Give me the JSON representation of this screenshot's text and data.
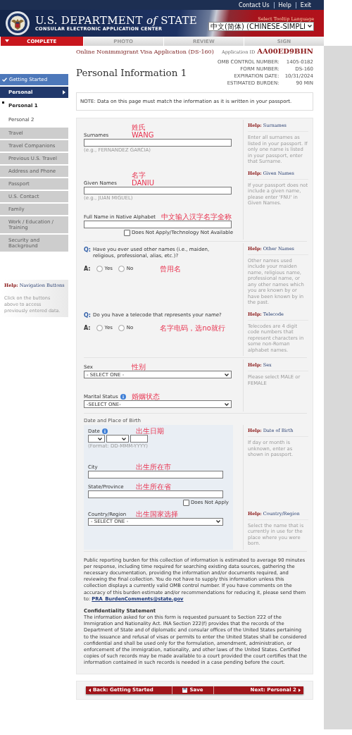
{
  "header": {
    "links": [
      "Contact Us",
      "Help",
      "Exit"
    ],
    "agency": "U.S. DEPARTMENT *of* STATE",
    "subtitle": "CONSULAR ELECTRONIC APPLICATION CENTER",
    "tooltip_label": "Select Tooltip Language",
    "language": "中文(简体) (CHINESE-SIMPLI"
  },
  "steps": [
    {
      "label": "COMPLETE",
      "selected": true
    },
    {
      "label": "PHOTO",
      "selected": false
    },
    {
      "label": "REVIEW",
      "selected": false
    },
    {
      "label": "SIGN",
      "selected": false
    }
  ],
  "sidebar": {
    "items": [
      {
        "kind": "done",
        "label": "Getting Started",
        "selected": false
      },
      {
        "kind": "section",
        "label": "Personal",
        "selected": false
      },
      {
        "kind": "sub",
        "label": "Personal 1",
        "selected": true
      },
      {
        "kind": "sub",
        "label": "Personal 2",
        "selected": false
      },
      {
        "kind": "pending",
        "label": "Travel",
        "selected": false
      },
      {
        "kind": "pending",
        "label": "Travel Companions",
        "selected": false
      },
      {
        "kind": "pending",
        "label": "Previous U.S. Travel",
        "selected": false
      },
      {
        "kind": "pending",
        "label": "Address and Phone",
        "selected": false
      },
      {
        "kind": "pending",
        "label": "Passport",
        "selected": false
      },
      {
        "kind": "pending",
        "label": "U.S. Contact",
        "selected": false
      },
      {
        "kind": "pending",
        "label": "Family",
        "selected": false
      },
      {
        "kind": "pending",
        "label": "Work / Education / Training",
        "selected": false
      },
      {
        "kind": "pending",
        "label": "Security and Background",
        "selected": false
      }
    ],
    "help": {
      "prefix": "Help:",
      "title": "Navigation Buttons",
      "text": "Click on the buttons above to access previously entered data."
    }
  },
  "form_title": "Online Nonimmigrant Visa Application (DS-160)",
  "application_id_label": "Application ID",
  "application_id": "AA00ED9BHN",
  "page_title": "Personal Information 1",
  "omb": [
    {
      "label": "OMB CONTROL NUMBER:",
      "value": "1405-0182"
    },
    {
      "label": "FORM NUMBER:",
      "value": "DS-160"
    },
    {
      "label": "EXPIRATION DATE:",
      "value": "10/31/2024"
    },
    {
      "label": "ESTIMATED BURDEN:",
      "value": "90 MIN"
    }
  ],
  "note": "NOTE: Data on this page must match the information as it is written in your passport.",
  "sections": [
    {
      "boxed": false,
      "items": [
        {
          "kind": "text",
          "label": "Surnames",
          "hint": "(e.g., FERNANDEZ GARCIA)",
          "notes": [
            "姓氏",
            "WANG"
          ],
          "help": {
            "prefix": "Help:",
            "title": "Surnames",
            "text": "Enter all surnames as listed in your passport. If only one name is listed in your passport, enter that Surname."
          }
        },
        {
          "kind": "text",
          "label": "Given Names",
          "hint": "(e.g., JUAN MIGUEL)",
          "notes": [
            "名字",
            "DANIU"
          ],
          "help": {
            "prefix": "Help:",
            "title": "Given Names",
            "text": "If your passport does not include a given name, please enter 'FNU' in Given Names."
          }
        },
        {
          "kind": "text",
          "label": "Full Name in Native Alphabet",
          "notes": [
            "中文输入汉字名字全称"
          ],
          "checkbox": {
            "label": "Does Not Apply/Technology Not Available",
            "checked": false
          }
        }
      ]
    },
    {
      "boxed": false,
      "items": [
        {
          "kind": "question",
          "q_marker": "Q:",
          "question": "Have you ever used other names (i.e., maiden, religious, professional, alias, etc.)?",
          "a_marker": "A:",
          "options": [
            {
              "label": "Yes",
              "selected": false
            },
            {
              "label": "No",
              "selected": false
            }
          ],
          "notes": [
            "曾用名"
          ],
          "help": {
            "prefix": "Help:",
            "title": "Other Names",
            "text": "Other names used include your maiden name, religious name, professional name, or any other names which you are known by or have been known by in the past."
          }
        },
        {
          "kind": "question",
          "q_marker": "Q:",
          "question": "Do you have a telecode that represents your name?",
          "a_marker": "A:",
          "options": [
            {
              "label": "Yes",
              "selected": false
            },
            {
              "label": "No",
              "selected": false
            }
          ],
          "notes": [
            "名字电码，选no就行"
          ],
          "help": {
            "prefix": "Help:",
            "title": "Telecode",
            "text": "Telecodes are 4 digit code numbers that represent characters in some non-Roman alphabet names."
          }
        }
      ]
    },
    {
      "boxed": false,
      "items": [
        {
          "kind": "select",
          "label": "Sex",
          "value": "- SELECT ONE -",
          "notes": [
            "性别"
          ],
          "help": {
            "prefix": "Help:",
            "title": "Sex",
            "text": "Please select MALE or FEMALE"
          }
        },
        {
          "kind": "select",
          "label": "Marital Status",
          "info": true,
          "value": "-SELECT ONE-",
          "notes": [
            "婚姻状态"
          ]
        }
      ]
    },
    {
      "title": "Date and Place of Birth",
      "boxed": true,
      "items": [
        {
          "kind": "date",
          "label": "Date",
          "info": true,
          "hint": "(Format: DD-MMM-YYYY)",
          "notes": [
            "出生日期"
          ],
          "help": {
            "prefix": "Help:",
            "title": "Date of Birth",
            "text": "If day or month is unknown, enter as shown in passport."
          }
        },
        {
          "kind": "text",
          "label": "City",
          "notes": [
            "出生所在市"
          ]
        },
        {
          "kind": "text",
          "label": "State/Province",
          "notes": [
            "出生所在省"
          ],
          "checkbox": {
            "label": "Does Not Apply",
            "checked": false
          }
        },
        {
          "kind": "select",
          "label": "Country/Region",
          "value": "- SELECT ONE -",
          "notes": [
            "出生国家选择"
          ],
          "help": {
            "prefix": "Help:",
            "title": "Country/Region",
            "text": "Select the name that is currently in use for the place where you were born."
          }
        }
      ]
    }
  ],
  "burden": {
    "text": "Public reporting burden for this collection of information is estimated to average 90 minutes per response, including time required for searching existing data sources, gathering the necessary documentation, providing the information and/or documents required, and reviewing the final collection. You do not have to supply this information unless this collection displays a currently valid OMB control number. If you have comments on the accuracy of this burden estimate and/or recommendations for reducing it, please send them to:",
    "link": "PRA_BurdenComments@state.gov"
  },
  "confidentiality": {
    "title": "Confidentiality Statement",
    "text": "The information asked for on this form is requested pursuant to Section 222 of the Immigration and Nationality Act. INA Section 222(f) provides that the records of the Department of State and of diplomatic and consular offices of the United States pertaining to the issuance and refusal of visas or permits to enter the United States shall be considered confidential and shall be used only for the formulation, amendment, administration, or enforcement of the immigration, nationality, and other laws of the United States. Certified copies of such records may be made available to a court provided the court certifies that the information contained in such records is needed in a case pending before the court."
  },
  "buttons": [
    {
      "kind": "back",
      "label": "Back: Getting Started"
    },
    {
      "kind": "save",
      "label": "Save"
    },
    {
      "kind": "next",
      "label": "Next: Personal 2"
    }
  ]
}
